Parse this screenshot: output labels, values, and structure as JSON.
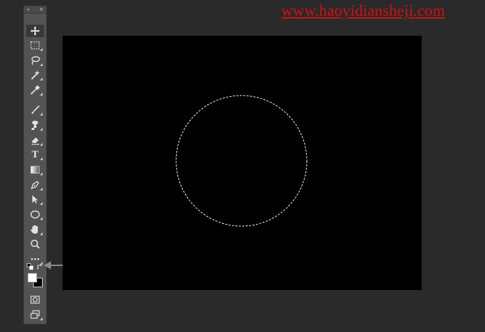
{
  "watermark": {
    "text": "www.haoyidiansheji.com",
    "color": "#d80e0e"
  },
  "toolbar": {
    "header_left": "»",
    "header_right": "✕",
    "tools": [
      {
        "name": "move-tool",
        "icon": "move-icon",
        "active": true
      },
      {
        "name": "marquee-tool",
        "icon": "rect-marquee-icon"
      },
      {
        "name": "lasso-tool",
        "icon": "lasso-icon"
      },
      {
        "name": "magic-wand-tool",
        "icon": "magic-wand-icon"
      },
      {
        "name": "eyedropper-tool",
        "icon": "eyedropper-icon"
      },
      {
        "name": "brush-tool",
        "icon": "brush-icon"
      },
      {
        "name": "clone-stamp-tool",
        "icon": "stamp-icon"
      },
      {
        "name": "eraser-tool",
        "icon": "eraser-icon"
      },
      {
        "name": "type-tool",
        "icon": "type-icon",
        "label": "T"
      },
      {
        "name": "gradient-tool",
        "icon": "gradient-icon"
      },
      {
        "name": "pen-tool",
        "icon": "pen-icon"
      },
      {
        "name": "path-selection-tool",
        "icon": "arrow-select-icon"
      },
      {
        "name": "ellipse-tool",
        "icon": "ellipse-icon"
      },
      {
        "name": "hand-tool",
        "icon": "hand-icon"
      },
      {
        "name": "zoom-tool",
        "icon": "zoom-icon"
      },
      {
        "name": "more-tools",
        "icon": "ellipsis-icon"
      }
    ],
    "colors": {
      "foreground": "#ffffff",
      "background": "#000000"
    }
  },
  "canvas": {
    "background": "#000000",
    "selection": "elliptical-marquee"
  }
}
